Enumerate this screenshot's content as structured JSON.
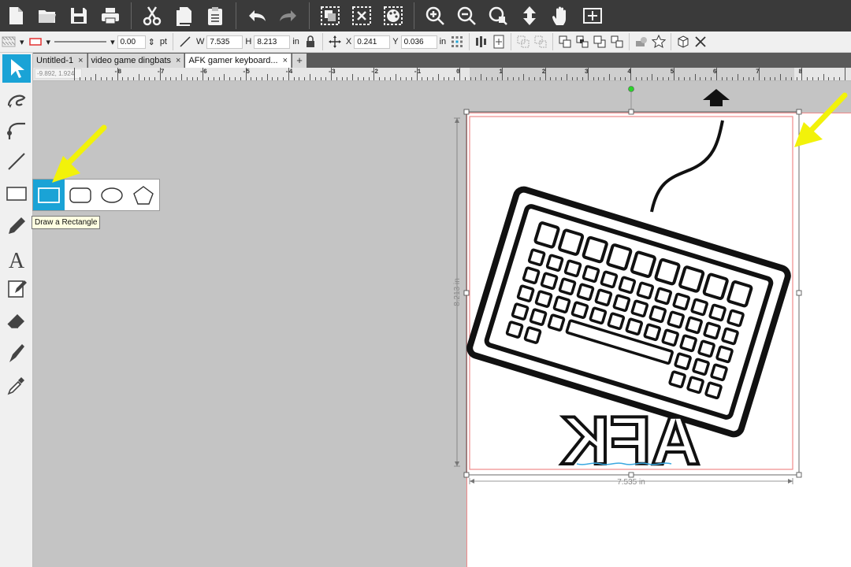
{
  "toolbar": {
    "items": [
      "new-file-icon",
      "open-folder-icon",
      "save-icon",
      "print-icon",
      "cut-icon",
      "copy-icon",
      "paste-icon",
      "undo-icon",
      "redo-icon",
      "group-icon",
      "ungroup-icon",
      "palette-icon",
      "zoom-in-icon",
      "zoom-out-icon",
      "zoom-selection-icon",
      "move-icon",
      "pan-hand-icon",
      "fit-page-icon"
    ]
  },
  "properties": {
    "line_width": "0.00",
    "line_unit": "pt",
    "width_label": "W",
    "width_value": "7.535",
    "height_label": "H",
    "height_value": "8.213",
    "size_unit": "in",
    "x_label": "X",
    "x_value": "0.241",
    "y_label": "Y",
    "y_value": "0.036",
    "pos_unit": "in"
  },
  "tabs": [
    {
      "label": "Untitled-1",
      "close": "×"
    },
    {
      "label": "video game dingbats",
      "close": "×"
    },
    {
      "label": "AFK gamer keyboard...",
      "close": "×"
    }
  ],
  "tab_add": "+",
  "ruler": {
    "readout": "-9.892, 1.924",
    "labels": [
      "-8",
      "-7",
      "-6",
      "-5",
      "-4",
      "-3",
      "-2",
      "-1",
      "0",
      "1",
      "2",
      "3",
      "4",
      "5",
      "6",
      "7",
      "8"
    ]
  },
  "tools": [
    "select-arrow-icon",
    "knife-swirl-icon",
    "bezier-icon",
    "line-icon",
    "rectangle-icon",
    "pencil-icon",
    "text-icon",
    "edit-points-icon",
    "eraser-icon",
    "knife-icon",
    "eyedropper-icon"
  ],
  "flyout": {
    "items": [
      "rectangle-icon",
      "rounded-rectangle-icon",
      "ellipse-icon",
      "polygon-icon"
    ],
    "tooltip": "Draw a Rectangle"
  },
  "artwork": {
    "afk_text": "AFK",
    "height_dim": "8.213 in",
    "width_dim": "7.535 in"
  },
  "colors": {
    "accent": "#1aa3d6",
    "annotation": "#f2f20a",
    "page_border": "#f08a8a"
  }
}
